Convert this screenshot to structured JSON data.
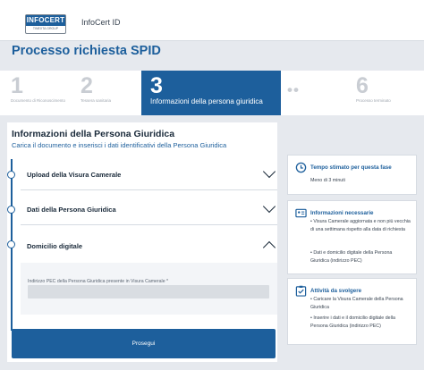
{
  "header": {
    "logo_main": "INFOCERT",
    "logo_sub": "TINEXTA GROUP",
    "app_name": "InfoCert ID"
  },
  "page": {
    "title": "Processo richiesta SPID"
  },
  "stepper": {
    "steps": [
      {
        "number": "1",
        "label": "Documento di Riconoscimento"
      },
      {
        "number": "2",
        "label": "Tessera sanitaria"
      },
      {
        "number": "3",
        "label": "Informazioni della persona giuridica"
      },
      {
        "number": "6",
        "label": "Processo terminato"
      }
    ],
    "dots": "••",
    "current_step_fraction": 0.5
  },
  "main": {
    "title": "Informazioni della Persona Giuridica",
    "subtitle": "Carica il documento e inserisci i dati identificativi della Persona Giuridica",
    "accordions": [
      {
        "title": "Upload della Visura Camerale",
        "icon": "chevron-down-icon"
      },
      {
        "title": "Dati della Persona Giuridica",
        "icon": "chevron-down-icon"
      },
      {
        "title": "Domicilio digitale",
        "icon": "chevron-up-icon"
      }
    ],
    "field": {
      "label": "Indirizzo PEC della Persona Giuridica presente in Visura Camerale *",
      "value": ""
    },
    "submit_label": "Prosegui"
  },
  "sidebar": {
    "time": {
      "title": "Tempo stimato per questa fase",
      "text": "Meno di 3 minuti",
      "icon": "clock-icon"
    },
    "info": {
      "title": "Informazioni necessarie",
      "icon": "id-card-icon",
      "items": [
        "• Visura Camerale aggiornata e non più vecchia di una settimana rispetto alla data di richiesta",
        "• Dati e domicilio digitale della Persona Giuridica (indirizzo PEC)"
      ]
    },
    "tasks": {
      "title": "Attività da svolgere",
      "icon": "checklist-icon",
      "items": [
        "• Caricare la Visura Camerale della Persona Giuridica",
        "• Inserire i dati e il domicilio digitale della Persona Giuridica (indirizzo PEC)"
      ]
    }
  },
  "colors": {
    "primary": "#1d5f9c",
    "background": "#e6e9ee",
    "text": "#1a2a3a"
  }
}
